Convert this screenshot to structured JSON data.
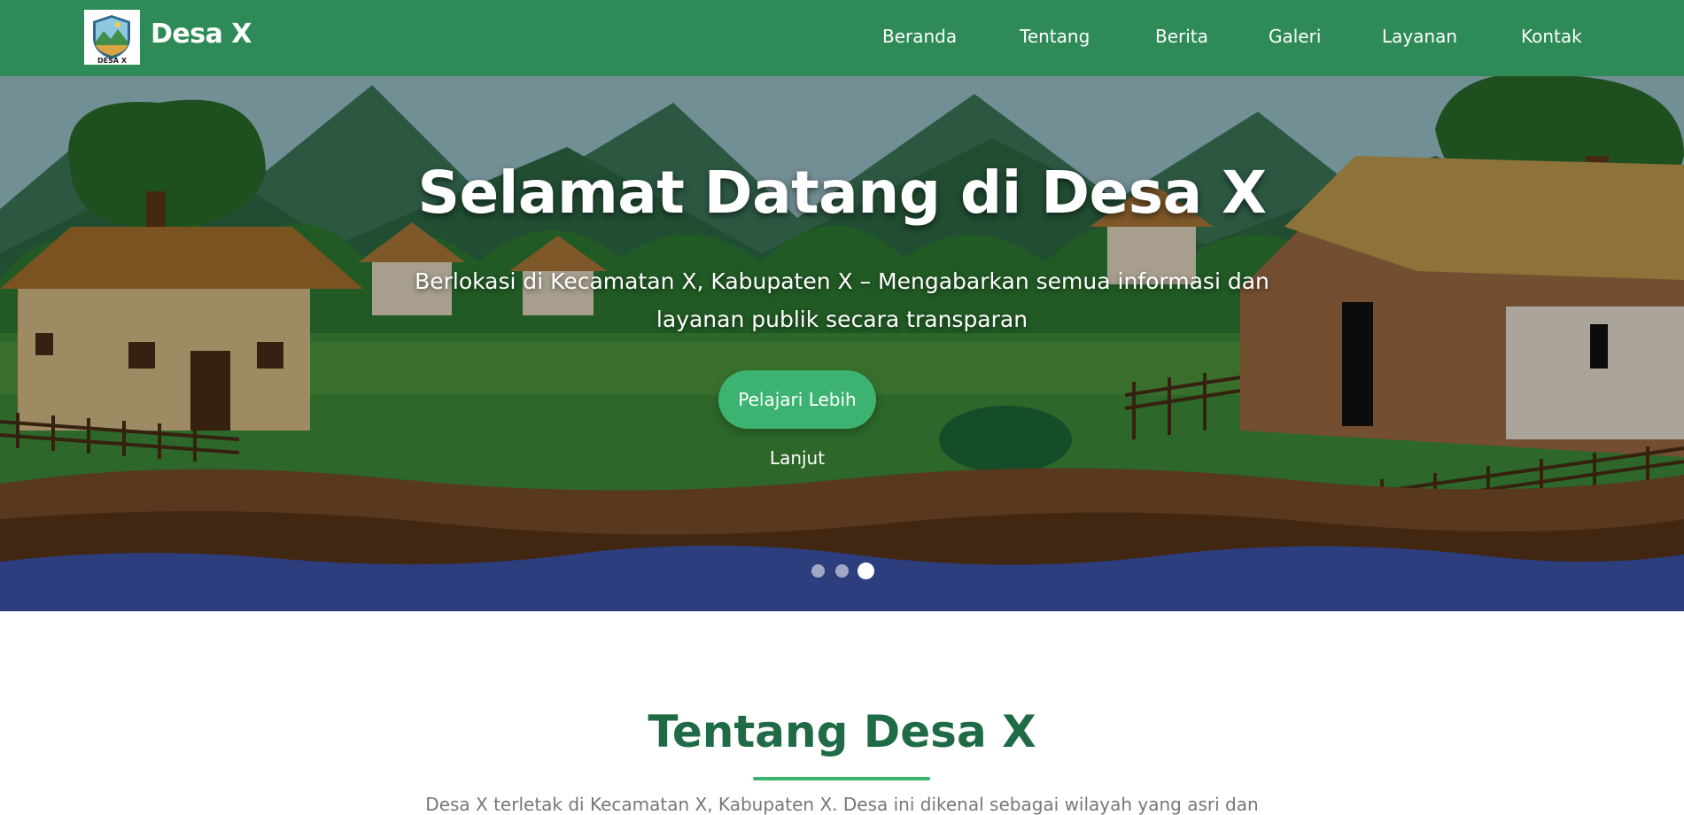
{
  "header": {
    "logo_text": "DESA X",
    "brand": "Desa X",
    "nav": [
      {
        "label": "Beranda"
      },
      {
        "label": "Tentang"
      },
      {
        "label": "Berita"
      },
      {
        "label": "Galeri"
      },
      {
        "label": "Layanan"
      },
      {
        "label": "Kontak"
      }
    ]
  },
  "hero": {
    "title": "Selamat Datang di Desa X",
    "subtitle": "Berlokasi di Kecamatan X, Kabupaten X – Mengabarkan semua informasi dan layanan publik secara transparan",
    "cta_label": "Pelajari Lebih Lanjut",
    "slides_total": 3,
    "active_slide": 3
  },
  "about": {
    "title": "Tentang Desa X",
    "intro": "Desa X terletak di Kecamatan X, Kabupaten X. Desa ini dikenal sebagai wilayah yang asri dan"
  },
  "colors": {
    "header_bg": "#2e8b57",
    "cta_bg": "#3cb371",
    "about_title": "#1f6b45",
    "accent_rule": "#3cb371"
  }
}
